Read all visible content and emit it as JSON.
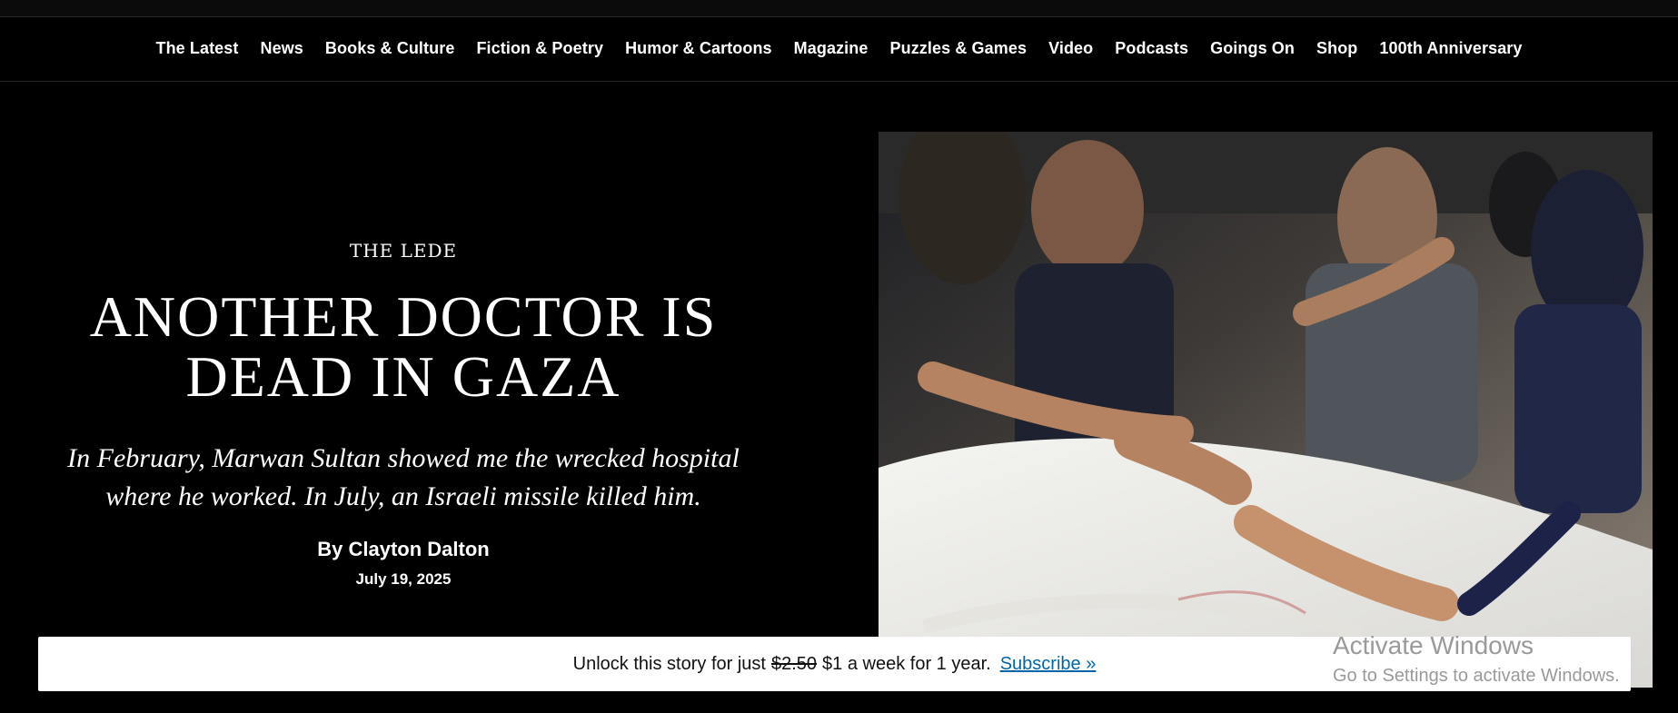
{
  "nav": {
    "items": [
      "The Latest",
      "News",
      "Books & Culture",
      "Fiction & Poetry",
      "Humor & Cartoons",
      "Magazine",
      "Puzzles & Games",
      "Video",
      "Podcasts",
      "Goings On",
      "Shop",
      "100th Anniversary"
    ]
  },
  "article": {
    "rubric": "THE LEDE",
    "headline": "ANOTHER DOCTOR IS DEAD IN GAZA",
    "dek": "In February, Marwan Sultan showed me the wrecked hospital where he worked. In July, an Israeli missile killed him.",
    "byline": "By Clayton Dalton",
    "date": "July 19, 2025"
  },
  "paywall": {
    "text": "Unlock this story for just",
    "old_price": "$2.50",
    "new_price": "$1 a week for 1 year.",
    "cta": "Subscribe »"
  },
  "system_overlay": {
    "title": "Activate Windows",
    "subtitle": "Go to Settings to activate Windows."
  },
  "colors": {
    "background": "#000000",
    "text": "#ffffff",
    "link": "#0065a8",
    "overlay_text": "#9a9a9a"
  }
}
